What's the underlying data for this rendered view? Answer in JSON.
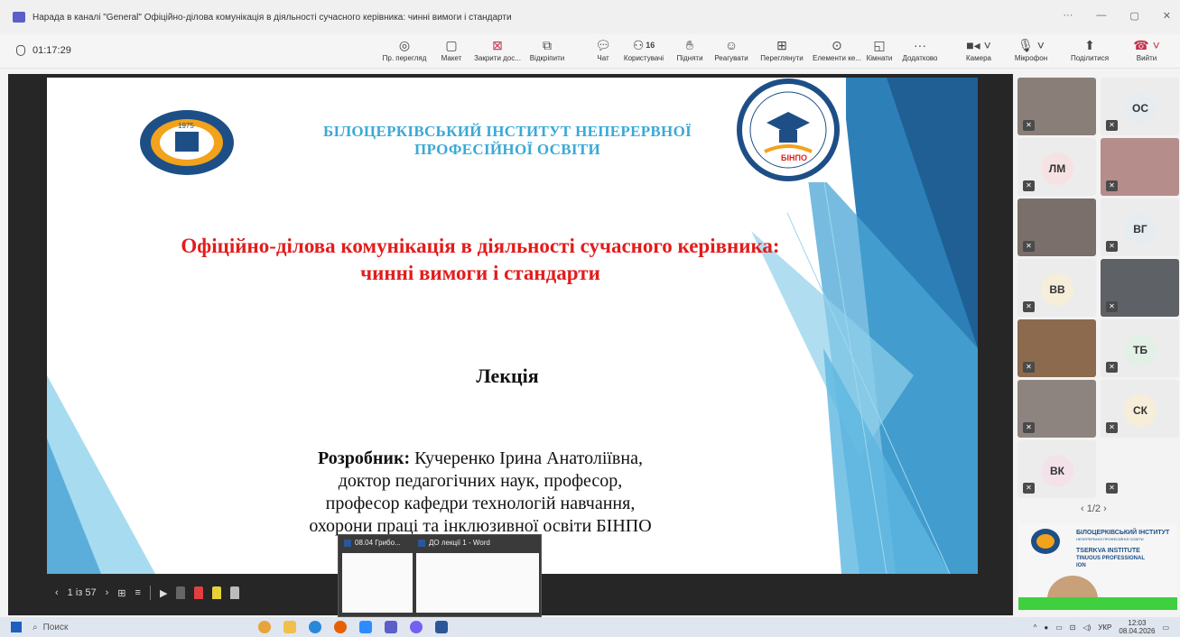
{
  "window": {
    "title": "Нарада в каналі \"General\" Офіційно-ділова комунікація в діяльності сучасного керівника: чинні вимоги і стандарти",
    "more": "···",
    "minimize": "—",
    "restore": "▢",
    "close": "✕"
  },
  "meeting": {
    "timer": "01:17:29",
    "participants_count": "16",
    "buttons": {
      "preview": "Пр. перегляд",
      "layout": "Макет",
      "close_share": "Закрити дос...",
      "popout": "Відкріпити",
      "chat": "Чат",
      "people": "Користувачі",
      "raise": "Підняти",
      "react": "Реагувати",
      "view": "Переглянути",
      "elements": "Елементи ке...",
      "rooms": "Кімнати",
      "more": "Додатково",
      "camera": "Камера",
      "mic": "Мікрофон",
      "share": "Поділитися",
      "leave": "Вийти"
    }
  },
  "slide": {
    "institute_line1": "БІЛОЦЕРКІВСЬКИЙ ІНСТИТУТ НЕПЕРЕРВНОЇ",
    "institute_line2": "ПРОФЕСІЙНОЇ ОСВІТИ",
    "title_line1": "Офіційно-ділова комунікація в діяльності сучасного керівника:",
    "title_line2": "чинні вимоги і стандарти",
    "label": "Лекція",
    "author_label": "Розробник:",
    "author_line1": "Кучеренко Ірина Анатоліївна,",
    "author_line2": "доктор педагогічних наук, професор,",
    "author_line3": "професор кафедри технологій навчання,",
    "author_line4": "охорони праці та інклюзивної освіти БІНПО",
    "logo_year": "1975",
    "logo_right_text": "БІНПО",
    "page_indicator": "1 із 57"
  },
  "thumbnails": {
    "item1": "08.04 Грибо...",
    "item2": "ДО лекції 1 - Word"
  },
  "participants": [
    {
      "initials": "",
      "video": true
    },
    {
      "initials": "ОС",
      "video": false,
      "color": "#e6ecf0"
    },
    {
      "initials": "ЛМ",
      "video": false,
      "color": "#f6e2e2"
    },
    {
      "initials": "",
      "video": true
    },
    {
      "initials": "",
      "video": true
    },
    {
      "initials": "ВГ",
      "video": false,
      "color": "#e6ecf0"
    },
    {
      "initials": "ВВ",
      "video": false,
      "color": "#f6eed8"
    },
    {
      "initials": "",
      "video": true
    },
    {
      "initials": "",
      "video": true
    },
    {
      "initials": "ТБ",
      "video": false,
      "color": "#e2f0e6"
    },
    {
      "initials": "",
      "video": true
    },
    {
      "initials": "СК",
      "video": false,
      "color": "#f6eed8"
    },
    {
      "initials": "ВК",
      "video": false,
      "color": "#f3e2ea"
    }
  ],
  "pager": "1/2",
  "preview": {
    "line1": "БІЛОЦЕРКІВСЬКИЙ ІНСТИТУТ",
    "line2": "НЕПЕРЕРВНОЇ ПРОФЕСІЙНОЇ ОСВІТИ",
    "line3": "TSERKVA INSTITUTE",
    "line4": "TINUOUS PROFESSIONAL",
    "line5": "ION"
  },
  "taskbar": {
    "search": "Поиск",
    "lang": "УКР",
    "time": "12:03",
    "date": "08.04.2026"
  }
}
